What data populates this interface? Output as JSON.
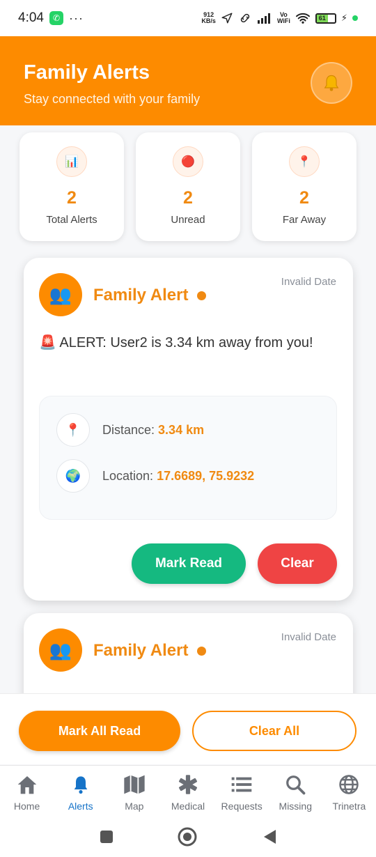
{
  "status_bar": {
    "time": "4:04",
    "dots": "···",
    "speed_value": "912",
    "speed_unit": "KB/s",
    "vowifi_top": "Vo",
    "vowifi_bottom": "WiFi",
    "battery": "61"
  },
  "header": {
    "title": "Family Alerts",
    "subtitle": "Stay connected with your family",
    "bell_icon": "bell-icon"
  },
  "stats": [
    {
      "icon": "📊",
      "value": "2",
      "label": "Total Alerts"
    },
    {
      "icon": "🔴",
      "value": "2",
      "label": "Unread"
    },
    {
      "icon": "📍",
      "value": "2",
      "label": "Far Away"
    }
  ],
  "alerts": [
    {
      "avatar_icon": "👥",
      "title": "Family Alert",
      "date": "Invalid Date",
      "message": "🚨 ALERT: User2 is 3.34 km away from you!",
      "distance_label": "Distance:",
      "distance_value": "3.34 km",
      "location_label": "Location:",
      "location_value": "17.6689, 75.9232",
      "mark_read_label": "Mark Read",
      "clear_label": "Clear"
    },
    {
      "avatar_icon": "👥",
      "title": "Family Alert",
      "date": "Invalid Date"
    }
  ],
  "actions": {
    "mark_all_read": "Mark All Read",
    "clear_all": "Clear All"
  },
  "nav": {
    "items": [
      {
        "label": "Home",
        "icon": "home-icon"
      },
      {
        "label": "Alerts",
        "icon": "bell-icon"
      },
      {
        "label": "Map",
        "icon": "map-icon"
      },
      {
        "label": "Medical",
        "icon": "medical-icon"
      },
      {
        "label": "Requests",
        "icon": "list-icon"
      },
      {
        "label": "Missing",
        "icon": "search-icon"
      },
      {
        "label": "Trinetra",
        "icon": "globe-icon"
      }
    ],
    "active": "Alerts"
  },
  "colors": {
    "brand": "#fd8b00",
    "accent_text": "#f08a12",
    "success": "#15b980",
    "danger": "#ef4444",
    "nav_active": "#1673c8"
  }
}
